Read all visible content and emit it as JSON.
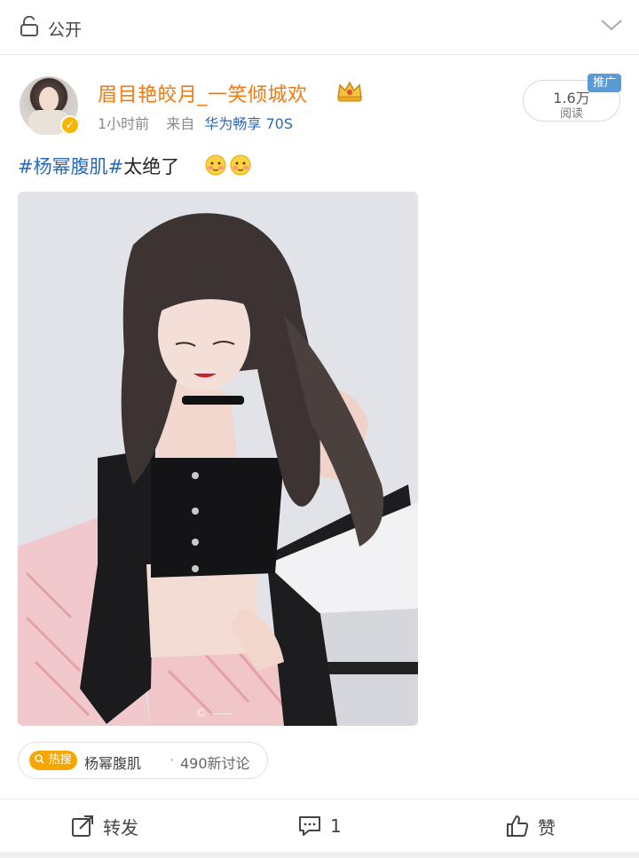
{
  "header": {
    "visibility_label": "公开",
    "icons": {
      "lock": "lock-icon",
      "expand": "chevron-down-icon"
    }
  },
  "post": {
    "author": {
      "username": "眉目艳皎月_一笑倾城欢",
      "verified": true,
      "badge_icon": "crown-icon"
    },
    "time": "1小时前",
    "source_prefix": "来自",
    "source": "华为畅享 70S",
    "read": {
      "count": "1.6万",
      "label": "阅读",
      "promo": "推广"
    },
    "text": {
      "hashtag": "#杨幂腹肌#",
      "body": "太绝了"
    },
    "emoji_icon": "blushing-emoji-icon",
    "image": {
      "semantic": "post-photo"
    }
  },
  "topic": {
    "hot_label": "热搜",
    "name": "杨幂腹肌",
    "separator": "·",
    "count": "490新讨论"
  },
  "actions": {
    "repost_label": "转发",
    "comment_count": "1",
    "like_label": "赞"
  },
  "colors": {
    "username": "#f07a10",
    "link": "#2b6ab5",
    "hot": "#f7a600",
    "promo": "#5b9bd5"
  }
}
